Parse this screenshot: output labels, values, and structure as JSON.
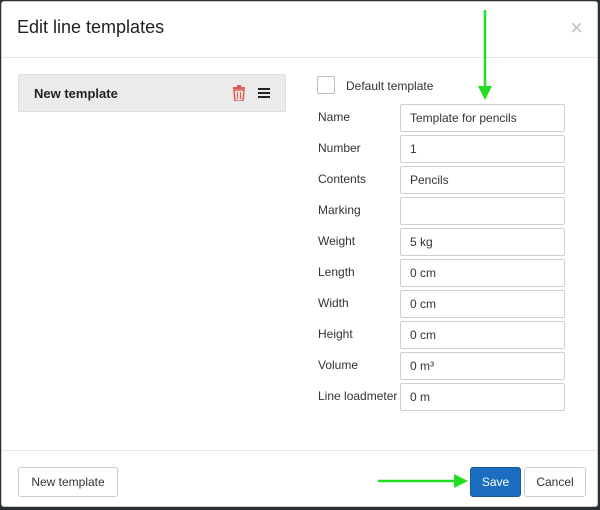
{
  "dialog": {
    "title": "Edit line templates",
    "close_glyph": "×"
  },
  "template_list": {
    "items": [
      {
        "label": "New template"
      }
    ]
  },
  "form": {
    "default_template": {
      "label": "Default template",
      "checked": false
    },
    "fields": [
      {
        "label": "Name",
        "value": "Template for pencils"
      },
      {
        "label": "Number",
        "value": "1"
      },
      {
        "label": "Contents",
        "value": "Pencils"
      },
      {
        "label": "Marking",
        "value": ""
      },
      {
        "label": "Weight",
        "value": "5 kg"
      },
      {
        "label": "Length",
        "value": "0 cm"
      },
      {
        "label": "Width",
        "value": "0 cm"
      },
      {
        "label": "Height",
        "value": "0 cm"
      },
      {
        "label": "Volume",
        "value": "0 m³"
      },
      {
        "label": "Line loadmeter",
        "value": "0 m"
      }
    ]
  },
  "footer": {
    "new_template_label": "New template",
    "save_label": "Save",
    "cancel_label": "Cancel"
  },
  "colors": {
    "primary": "#1a6dbf",
    "delete_icon": "#e05a4f",
    "annotation_arrow": "#22dd22"
  },
  "icons": {
    "delete": "trash-icon",
    "reorder": "menu-icon",
    "close": "close-icon"
  }
}
